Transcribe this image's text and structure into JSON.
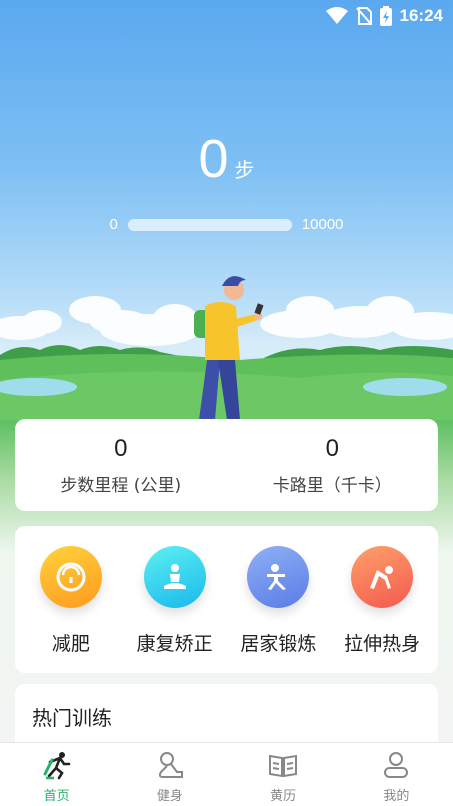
{
  "status_bar": {
    "time": "16:24"
  },
  "steps": {
    "count": "0",
    "unit": "步"
  },
  "progress": {
    "min": "0",
    "max": "10000",
    "fraction": 0
  },
  "stats": [
    {
      "value": "0",
      "label": "步数里程 (公里)"
    },
    {
      "value": "0",
      "label": "卡路里（千卡）"
    }
  ],
  "categories": [
    {
      "label": "减肥",
      "icon": "scale-icon",
      "color_from": "#ffd23c",
      "color_to": "#ff9a1f"
    },
    {
      "label": "康复矫正",
      "icon": "meditation-icon",
      "color_from": "#5df0f2",
      "color_to": "#1ab8ec"
    },
    {
      "label": "居家锻炼",
      "icon": "exercise-icon",
      "color_from": "#8fb0f5",
      "color_to": "#5a7ce6"
    },
    {
      "label": "拉伸热身",
      "icon": "stretch-icon",
      "color_from": "#ffa06b",
      "color_to": "#f25a4e"
    }
  ],
  "hot_training": {
    "title": "热门训练"
  },
  "tabs": [
    {
      "label": "首页",
      "icon": "runner-icon",
      "active": true
    },
    {
      "label": "健身",
      "icon": "fitness-icon",
      "active": false
    },
    {
      "label": "黄历",
      "icon": "book-icon",
      "active": false
    },
    {
      "label": "我的",
      "icon": "user-icon",
      "active": false
    }
  ],
  "colors": {
    "accent": "#26b36a",
    "sky": "#5aa8ef",
    "grass": "#5fbf63"
  }
}
